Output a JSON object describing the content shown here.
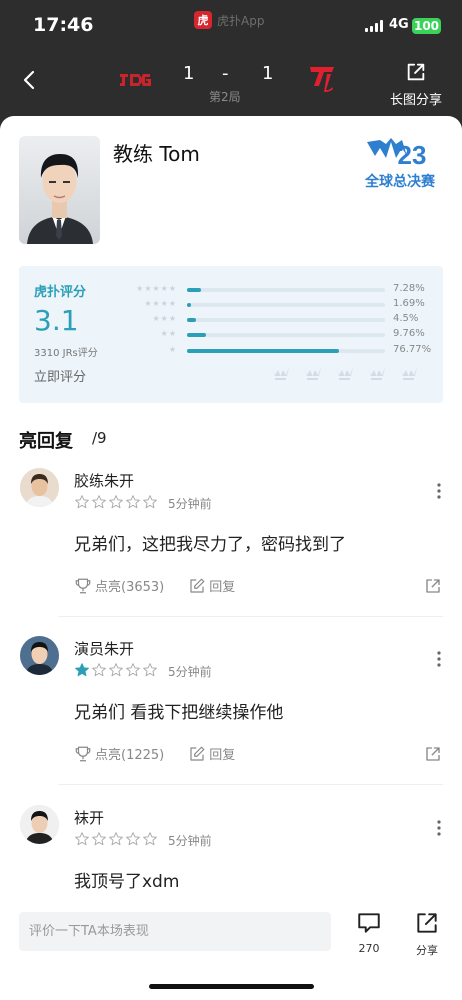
{
  "status_bar": {
    "time": "17:46",
    "app_name": "虎扑App",
    "app_logo_text": "虎",
    "network": "4G",
    "battery": "100"
  },
  "match": {
    "score_left": "1",
    "dash": "-",
    "score_right": "1",
    "game_label": "第2局",
    "team_left": "JDG",
    "team_right": "T1",
    "share_label": "长图分享"
  },
  "coach": {
    "name": "教练 Tom",
    "event": "全球总决赛",
    "event_number": "23"
  },
  "rating": {
    "title": "虎扑评分",
    "score": "3.1",
    "count": "3310 JRs评分",
    "rate_prompt": "立即评分",
    "distribution": [
      {
        "stars": 5,
        "stars_text": "★★★★★",
        "percent_label": "7.28%",
        "value": 7.28
      },
      {
        "stars": 4,
        "stars_text": "★★★★",
        "percent_label": "1.69%",
        "value": 1.69
      },
      {
        "stars": 3,
        "stars_text": "★★★",
        "percent_label": "4.5%",
        "value": 4.5
      },
      {
        "stars": 2,
        "stars_text": "★★",
        "percent_label": "9.76%",
        "value": 9.76
      },
      {
        "stars": 1,
        "stars_text": "★",
        "percent_label": "76.77%",
        "value": 76.77
      }
    ]
  },
  "replies": {
    "heading": "亮回复",
    "count": "/9",
    "items": [
      {
        "name": "胶练朱开",
        "stars": 0,
        "time": "5分钟前",
        "text": "兄弟们，这把我尽力了，密码找到了",
        "likes_label": "点亮(3653)",
        "reply_label": "回复"
      },
      {
        "name": "演员朱开",
        "stars": 1,
        "time": "5分钟前",
        "text": "兄弟们 看我下把继续操作他",
        "likes_label": "点亮(1225)",
        "reply_label": "回复"
      },
      {
        "name": "袜开",
        "stars": 0,
        "time": "5分钟前",
        "text": "我顶号了xdm",
        "likes_label": "",
        "reply_label": ""
      }
    ]
  },
  "bottom_bar": {
    "input_placeholder": "评价一下TA本场表现",
    "comment_count": "270",
    "share_label": "分享"
  },
  "colors": {
    "accent": "#2b9fb8",
    "brand_red": "#d8262f",
    "header_bg": "#2d2d2d"
  }
}
